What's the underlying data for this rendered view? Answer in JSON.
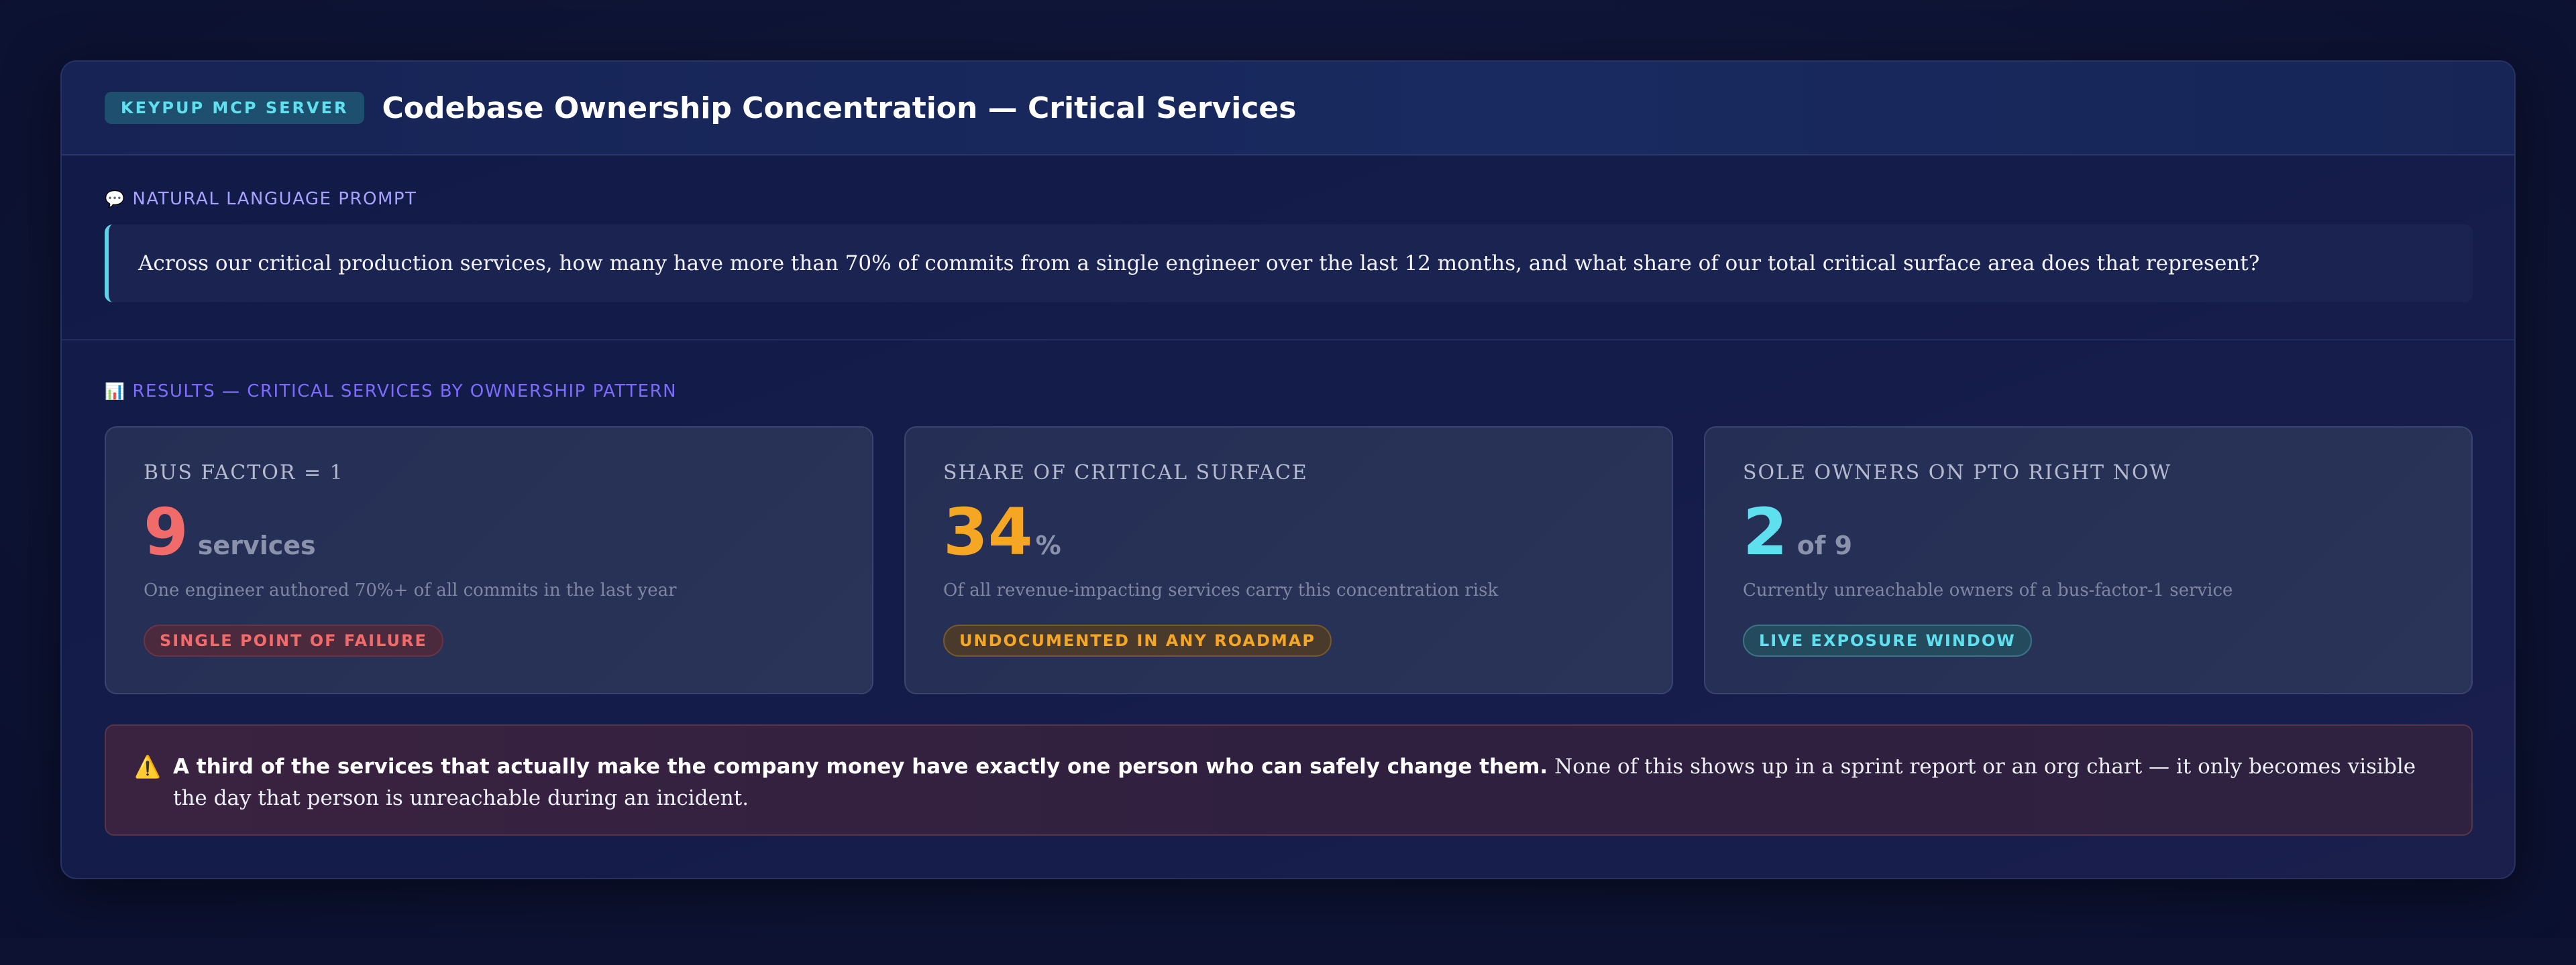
{
  "header": {
    "badge": "KEYPUP MCP SERVER",
    "title": "Codebase Ownership Concentration — Critical Services"
  },
  "prompt": {
    "label": "NATURAL LANGUAGE PROMPT",
    "icon": "speech-bubble-icon",
    "text": "Across our critical production services, how many have more than 70% of commits from a single engineer over the last 12 months, and what share of our total critical surface area does that represent?"
  },
  "results": {
    "label": "RESULTS — CRITICAL SERVICES BY OWNERSHIP PATTERN",
    "icon": "bar-chart-icon",
    "cards": [
      {
        "title": "BUS FACTOR = 1",
        "value": "9",
        "unit": "services",
        "description": "One engineer authored 70%+ of all commits in the last year",
        "tag": "SINGLE POINT OF FAILURE",
        "color": "#f26b6b",
        "tag_bg": "#4a2a3c",
        "tag_border": "#6a3344"
      },
      {
        "title": "SHARE OF CRITICAL SURFACE",
        "value": "34",
        "unit": "%",
        "description": "Of all revenue-impacting services carry this concentration risk",
        "tag": "UNDOCUMENTED IN ANY ROADMAP",
        "color": "#f5a623",
        "tag_bg": "#4a3a2c",
        "tag_border": "#76592a"
      },
      {
        "title": "SOLE OWNERS ON PTO RIGHT NOW",
        "value": "2",
        "unit": "of 9",
        "description": "Currently unreachable owners of a bus-factor-1 service",
        "tag": "LIVE EXPOSURE WINDOW",
        "color": "#5fe0ee",
        "tag_bg": "#244a5e",
        "tag_border": "#3d7386"
      }
    ]
  },
  "alert": {
    "icon": "warning-icon",
    "bold": "A third of the services that actually make the company money have exactly one person who can safely change them.",
    "rest": " None of this shows up in a sprint report or an org chart — it only becomes visible the day that person is unreachable during an incident."
  }
}
